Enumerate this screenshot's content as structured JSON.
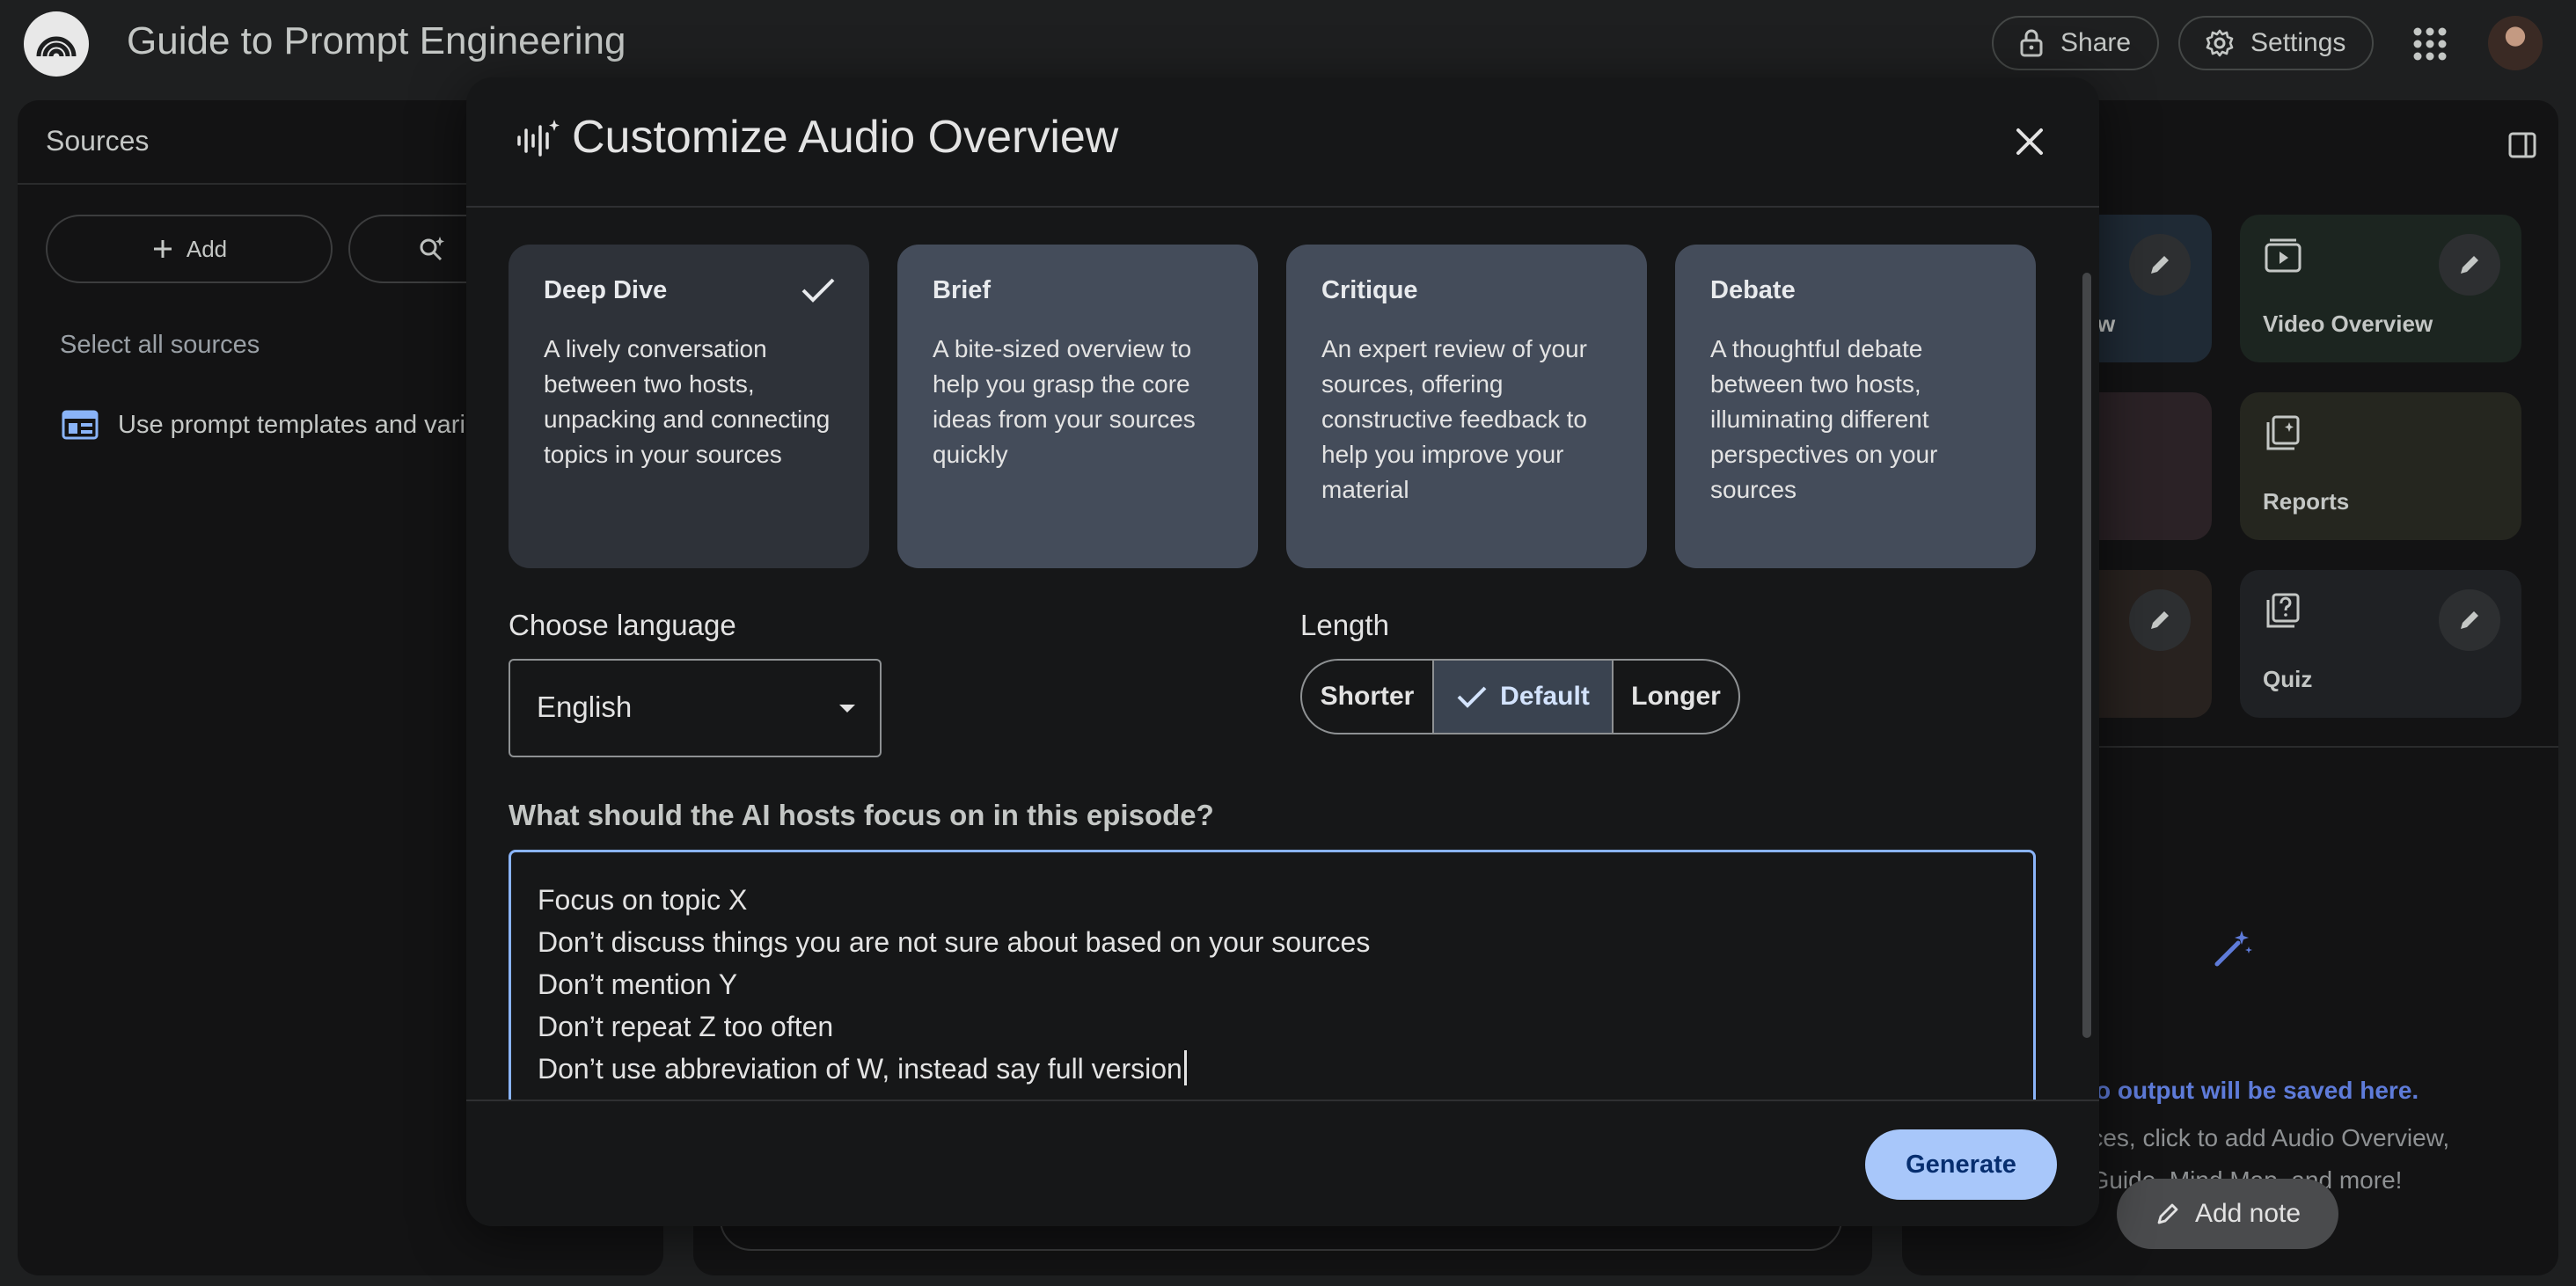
{
  "app": {
    "title": "Guide to Prompt Engineering"
  },
  "header": {
    "share_label": "Share",
    "settings_label": "Settings"
  },
  "sources": {
    "title": "Sources",
    "add_label": "Add",
    "discover_label": "Discover",
    "select_all_label": "Select all sources",
    "items": [
      {
        "label": "Use prompt templates and varia"
      }
    ]
  },
  "studio": {
    "tiles": [
      {
        "label": "Audio Overview",
        "visible_label": "w"
      },
      {
        "label": "Video Overview"
      },
      {
        "label": ""
      },
      {
        "label": "Reports"
      },
      {
        "label": ""
      },
      {
        "label": "Quiz"
      }
    ],
    "empty_title": "o output will be saved here.",
    "empty_desc_line1": "sources, click to add Audio Overview,",
    "empty_desc_line2": "Guide, Mind Map, and more!",
    "add_note_label": "Add note"
  },
  "dialog": {
    "title": "Customize Audio Overview",
    "formats": [
      {
        "name": "Deep Dive",
        "desc": "A lively conversation between two hosts, unpacking and connecting topics in your sources",
        "selected": true
      },
      {
        "name": "Brief",
        "desc": "A bite-sized overview to help you grasp the core ideas from your sources quickly",
        "selected": false
      },
      {
        "name": "Critique",
        "desc": "An expert review of your sources, offering constructive feedback to help you improve your material",
        "selected": false
      },
      {
        "name": "Debate",
        "desc": "A thoughtful debate between two hosts, illuminating different perspectives on your sources",
        "selected": false
      }
    ],
    "language": {
      "label": "Choose language",
      "value": "English"
    },
    "length": {
      "label": "Length",
      "options": [
        "Shorter",
        "Default",
        "Longer"
      ],
      "selected": "Default"
    },
    "focus": {
      "label": "What should the AI hosts focus on in this episode?",
      "lines": [
        "Focus on topic X",
        "Don’t discuss things you are not sure about based on your sources",
        "Don’t mention Y",
        "Don’t repeat Z too often",
        "Don’t use abbreviation of W, instead say full version"
      ]
    },
    "generate_label": "Generate"
  },
  "colors": {
    "accent": "#a8c7fa",
    "selected_card": "#2e3239",
    "card": "#444c5a",
    "focus_border": "#8ab4f8"
  }
}
